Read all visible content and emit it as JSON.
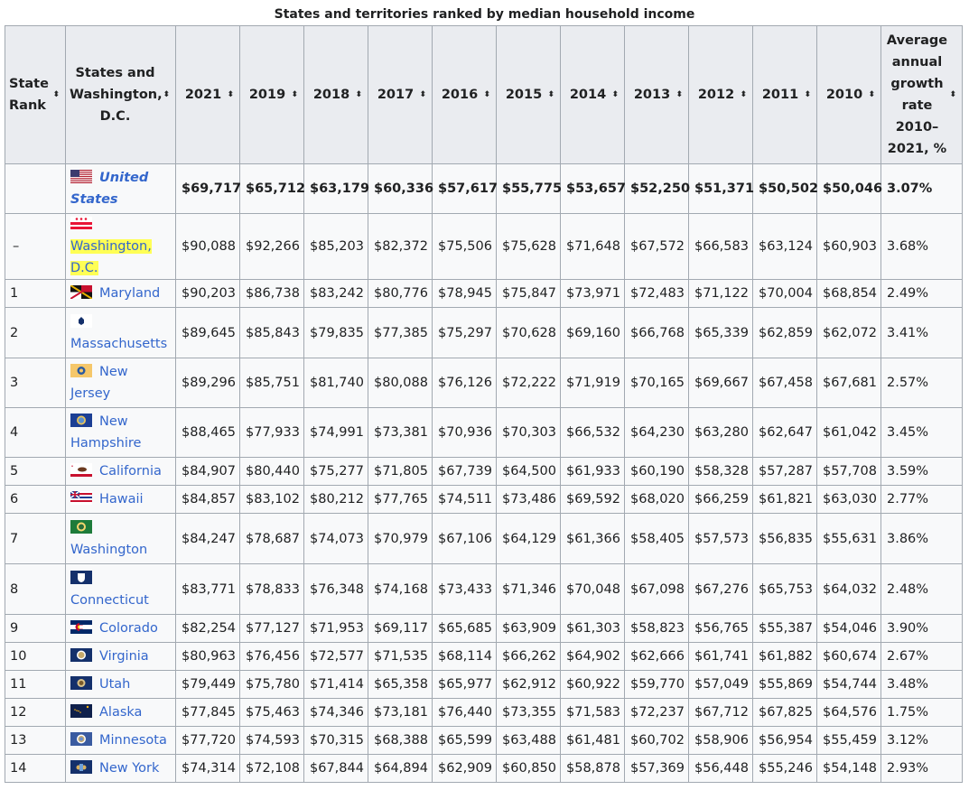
{
  "caption": "States and territories ranked by median household income",
  "headers": {
    "rank": "State Rank",
    "state": "States and Washington, D.C.",
    "years": [
      "2021",
      "2019",
      "2018",
      "2017",
      "2016",
      "2015",
      "2014",
      "2013",
      "2012",
      "2011",
      "2010"
    ],
    "growth": "Average annual growth rate 2010–2021, %"
  },
  "sort_glyph": "⬍",
  "rows": [
    {
      "rank": "",
      "name": "United States",
      "flag": "us-flag",
      "values": [
        "$69,717",
        "$65,712",
        "$63,179",
        "$60,336",
        "$57,617",
        "$55,775",
        "$53,657",
        "$52,250",
        "$51,371",
        "$50,502",
        "$50,046"
      ],
      "growth": "3.07%"
    },
    {
      "rank": "–",
      "name": "Washington, D.C.",
      "flag": "dc-flag",
      "values": [
        "$90,088",
        "$92,266",
        "$85,203",
        "$82,372",
        "$75,506",
        "$75,628",
        "$71,648",
        "$67,572",
        "$66,583",
        "$63,124",
        "$60,903"
      ],
      "growth": "3.68%"
    },
    {
      "rank": "1",
      "name": "Maryland",
      "flag": "maryland-flag",
      "values": [
        "$90,203",
        "$86,738",
        "$83,242",
        "$80,776",
        "$78,945",
        "$75,847",
        "$73,971",
        "$72,483",
        "$71,122",
        "$70,004",
        "$68,854"
      ],
      "growth": "2.49%"
    },
    {
      "rank": "2",
      "name": "Massachusetts",
      "flag": "massachusetts-flag",
      "values": [
        "$89,645",
        "$85,843",
        "$79,835",
        "$77,385",
        "$75,297",
        "$70,628",
        "$69,160",
        "$66,768",
        "$65,339",
        "$62,859",
        "$62,072"
      ],
      "growth": "3.41%"
    },
    {
      "rank": "3",
      "name": "New Jersey",
      "flag": "new-jersey-flag",
      "values": [
        "$89,296",
        "$85,751",
        "$81,740",
        "$80,088",
        "$76,126",
        "$72,222",
        "$71,919",
        "$70,165",
        "$69,667",
        "$67,458",
        "$67,681"
      ],
      "growth": "2.57%"
    },
    {
      "rank": "4",
      "name": "New Hampshire",
      "flag": "new-hampshire-flag",
      "values": [
        "$88,465",
        "$77,933",
        "$74,991",
        "$73,381",
        "$70,936",
        "$70,303",
        "$66,532",
        "$64,230",
        "$63,280",
        "$62,647",
        "$61,042"
      ],
      "growth": "3.45%"
    },
    {
      "rank": "5",
      "name": "California",
      "flag": "california-flag",
      "values": [
        "$84,907",
        "$80,440",
        "$75,277",
        "$71,805",
        "$67,739",
        "$64,500",
        "$61,933",
        "$60,190",
        "$58,328",
        "$57,287",
        "$57,708"
      ],
      "growth": "3.59%"
    },
    {
      "rank": "6",
      "name": "Hawaii",
      "flag": "hawaii-flag",
      "values": [
        "$84,857",
        "$83,102",
        "$80,212",
        "$77,765",
        "$74,511",
        "$73,486",
        "$69,592",
        "$68,020",
        "$66,259",
        "$61,821",
        "$63,030"
      ],
      "growth": "2.77%"
    },
    {
      "rank": "7",
      "name": "Washington",
      "flag": "washington-flag",
      "values": [
        "$84,247",
        "$78,687",
        "$74,073",
        "$70,979",
        "$67,106",
        "$64,129",
        "$61,366",
        "$58,405",
        "$57,573",
        "$56,835",
        "$55,631"
      ],
      "growth": "3.86%"
    },
    {
      "rank": "8",
      "name": "Connecticut",
      "flag": "connecticut-flag",
      "values": [
        "$83,771",
        "$78,833",
        "$76,348",
        "$74,168",
        "$73,433",
        "$71,346",
        "$70,048",
        "$67,098",
        "$67,276",
        "$65,753",
        "$64,032"
      ],
      "growth": "2.48%"
    },
    {
      "rank": "9",
      "name": "Colorado",
      "flag": "colorado-flag",
      "values": [
        "$82,254",
        "$77,127",
        "$71,953",
        "$69,117",
        "$65,685",
        "$63,909",
        "$61,303",
        "$58,823",
        "$56,765",
        "$55,387",
        "$54,046"
      ],
      "growth": "3.90%"
    },
    {
      "rank": "10",
      "name": "Virginia",
      "flag": "virginia-flag",
      "values": [
        "$80,963",
        "$76,456",
        "$72,577",
        "$71,535",
        "$68,114",
        "$66,262",
        "$64,902",
        "$62,666",
        "$61,741",
        "$61,882",
        "$60,674"
      ],
      "growth": "2.67%"
    },
    {
      "rank": "11",
      "name": "Utah",
      "flag": "utah-flag",
      "values": [
        "$79,449",
        "$75,780",
        "$71,414",
        "$65,358",
        "$65,977",
        "$62,912",
        "$60,922",
        "$59,770",
        "$57,049",
        "$55,869",
        "$54,744"
      ],
      "growth": "3.48%"
    },
    {
      "rank": "12",
      "name": "Alaska",
      "flag": "alaska-flag",
      "values": [
        "$77,845",
        "$75,463",
        "$74,346",
        "$73,181",
        "$76,440",
        "$73,355",
        "$71,583",
        "$72,237",
        "$67,712",
        "$67,825",
        "$64,576"
      ],
      "growth": "1.75%"
    },
    {
      "rank": "13",
      "name": "Minnesota",
      "flag": "minnesota-flag",
      "values": [
        "$77,720",
        "$74,593",
        "$70,315",
        "$68,388",
        "$65,599",
        "$63,488",
        "$61,481",
        "$60,702",
        "$58,906",
        "$56,954",
        "$55,459"
      ],
      "growth": "3.12%"
    },
    {
      "rank": "14",
      "name": "New York",
      "flag": "new-york-flag",
      "values": [
        "$74,314",
        "$72,108",
        "$67,844",
        "$64,894",
        "$62,909",
        "$60,850",
        "$58,878",
        "$57,369",
        "$56,448",
        "$55,246",
        "$54,148"
      ],
      "growth": "2.93%"
    }
  ]
}
